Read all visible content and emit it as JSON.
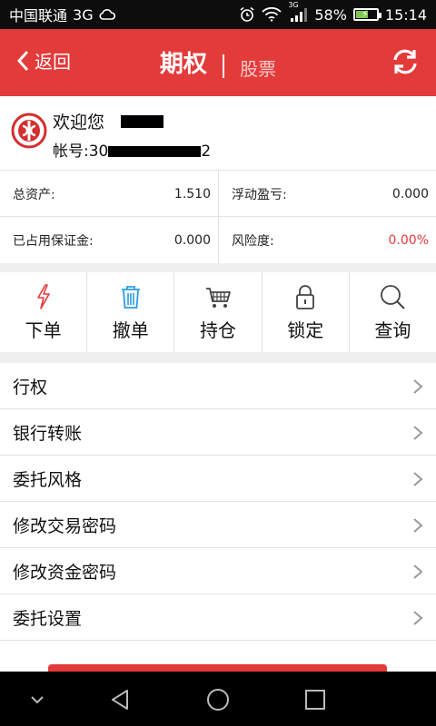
{
  "status_bar": {
    "carrier": "中国联通",
    "network": "3G",
    "signal_tag": "3G",
    "battery": "58%",
    "battery_level": 0.58,
    "time": "15:14"
  },
  "header": {
    "back_label": "返回",
    "title": "期权",
    "subtitle": "股票",
    "accent_color": "#e33a3a"
  },
  "account": {
    "welcome": "欢迎您",
    "account_prefix": "帐号:30",
    "account_suffix": "2"
  },
  "stats": {
    "total_assets_label": "总资产:",
    "total_assets_value": "1.510",
    "floating_pl_label": "浮动盈亏:",
    "floating_pl_value": "0.000",
    "margin_used_label": "已占用保证金:",
    "margin_used_value": "0.000",
    "risk_label": "风险度:",
    "risk_value": "0.00%",
    "risk_color": "#e33a3a"
  },
  "actions": [
    {
      "label": "下单",
      "icon": "lightning-icon"
    },
    {
      "label": "撤单",
      "icon": "trash-icon"
    },
    {
      "label": "持仓",
      "icon": "cart-icon"
    },
    {
      "label": "锁定",
      "icon": "lock-icon"
    },
    {
      "label": "查询",
      "icon": "search-icon"
    }
  ],
  "menu": [
    {
      "label": "行权"
    },
    {
      "label": "银行转账"
    },
    {
      "label": "委托风格"
    },
    {
      "label": "修改交易密码"
    },
    {
      "label": "修改资金密码"
    },
    {
      "label": "委托设置"
    }
  ],
  "nav_bar": {
    "icons": [
      "chevron-down-icon",
      "back-triangle-icon",
      "home-circle-icon",
      "recents-square-icon"
    ]
  }
}
